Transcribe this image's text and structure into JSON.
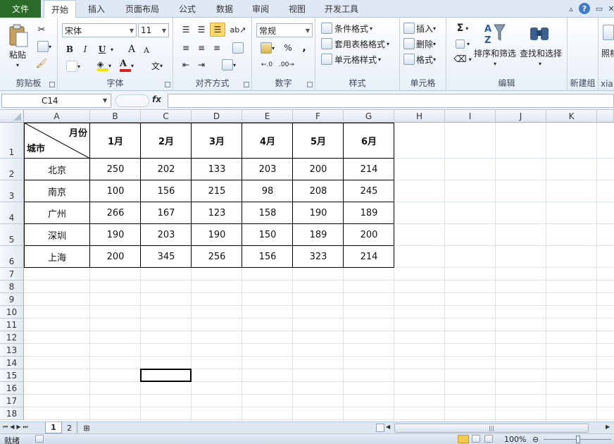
{
  "tabs": {
    "file": "文件",
    "items": [
      "开始",
      "插入",
      "页面布局",
      "公式",
      "数据",
      "审阅",
      "视图",
      "开发工具"
    ]
  },
  "ribbon": {
    "clipboard": {
      "label": "剪贴板",
      "paste": "粘贴"
    },
    "font": {
      "label": "字体",
      "name": "宋体",
      "size": "11",
      "bold": "B",
      "italic": "I",
      "underline": "U",
      "grow": "A",
      "shrink": "A"
    },
    "align": {
      "label": "对齐方式"
    },
    "number": {
      "label": "数字",
      "format": "常规",
      "percent": "%",
      "comma": ","
    },
    "styles": {
      "label": "样式",
      "cond": "条件格式",
      "table": "套用表格格式",
      "cell": "单元格样式"
    },
    "cells": {
      "label": "单元格",
      "insert": "插入",
      "delete": "删除",
      "format": "格式"
    },
    "editing": {
      "label": "编辑",
      "sort": "排序和筛选",
      "find": "查找和选择",
      "sum": "Σ"
    },
    "newgroup": {
      "label": "新建组"
    },
    "extra": {
      "label": "xia",
      "photo": "照相"
    }
  },
  "formula": {
    "namebox": "C14",
    "fx": "fx",
    "value": ""
  },
  "columns": [
    "A",
    "B",
    "C",
    "D",
    "E",
    "F",
    "G",
    "H",
    "I",
    "J",
    "K"
  ],
  "rows": [
    "1",
    "2",
    "3",
    "4",
    "5",
    "6",
    "7",
    "8",
    "9",
    "10",
    "11",
    "12",
    "13",
    "14",
    "15",
    "16",
    "17",
    "18"
  ],
  "table": {
    "corner_top": "月份",
    "corner_bottom": "城市",
    "months": [
      "1月",
      "2月",
      "3月",
      "4月",
      "5月",
      "6月"
    ],
    "data": [
      {
        "city": "北京",
        "values": [
          "250",
          "202",
          "133",
          "203",
          "200",
          "214"
        ]
      },
      {
        "city": "南京",
        "values": [
          "100",
          "156",
          "215",
          "98",
          "208",
          "245"
        ]
      },
      {
        "city": "广州",
        "values": [
          "266",
          "167",
          "123",
          "158",
          "190",
          "189"
        ]
      },
      {
        "city": "深圳",
        "values": [
          "190",
          "203",
          "190",
          "150",
          "189",
          "200"
        ]
      },
      {
        "city": "上海",
        "values": [
          "200",
          "345",
          "256",
          "156",
          "323",
          "214"
        ]
      }
    ]
  },
  "sheets": [
    "1",
    "2"
  ],
  "status": {
    "ready": "就绪",
    "zoom": "100%"
  }
}
